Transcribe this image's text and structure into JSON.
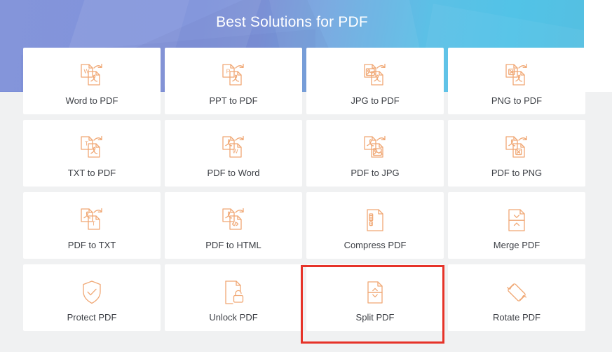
{
  "header": {
    "title": "Best Solutions for PDF",
    "gradient_from": "#7d8fd8",
    "gradient_to": "#52c3e7",
    "title_color": "#ffffff"
  },
  "theme": {
    "page_background": "#f0f1f2",
    "card_background": "#ffffff",
    "icon_color": "#f0a875",
    "label_color": "#3c3f45",
    "highlight_color": "#e63329"
  },
  "annotation": {
    "target": "Split PDF",
    "color": "#e63329",
    "style": "rectangle-outline"
  },
  "grid": {
    "columns": 4,
    "rows": 4,
    "cards": [
      {
        "label": "Word to PDF",
        "icon": "word-to-pdf-icon",
        "highlighted": false
      },
      {
        "label": "PPT to PDF",
        "icon": "ppt-to-pdf-icon",
        "highlighted": false
      },
      {
        "label": "JPG to PDF",
        "icon": "jpg-to-pdf-icon",
        "highlighted": false
      },
      {
        "label": "PNG to PDF",
        "icon": "png-to-pdf-icon",
        "highlighted": false
      },
      {
        "label": "TXT to PDF",
        "icon": "txt-to-pdf-icon",
        "highlighted": false
      },
      {
        "label": "PDF to Word",
        "icon": "pdf-to-word-icon",
        "highlighted": false
      },
      {
        "label": "PDF to JPG",
        "icon": "pdf-to-jpg-icon",
        "highlighted": false
      },
      {
        "label": "PDF to PNG",
        "icon": "pdf-to-png-icon",
        "highlighted": false
      },
      {
        "label": "PDF to TXT",
        "icon": "pdf-to-txt-icon",
        "highlighted": false
      },
      {
        "label": "PDF to HTML",
        "icon": "pdf-to-html-icon",
        "highlighted": false
      },
      {
        "label": "Compress PDF",
        "icon": "compress-pdf-icon",
        "highlighted": false
      },
      {
        "label": "Merge PDF",
        "icon": "merge-pdf-icon",
        "highlighted": false
      },
      {
        "label": "Protect PDF",
        "icon": "protect-pdf-icon",
        "highlighted": false
      },
      {
        "label": "Unlock PDF",
        "icon": "unlock-pdf-icon",
        "highlighted": false
      },
      {
        "label": "Split PDF",
        "icon": "split-pdf-icon",
        "highlighted": true
      },
      {
        "label": "Rotate PDF",
        "icon": "rotate-pdf-icon",
        "highlighted": false
      }
    ]
  }
}
